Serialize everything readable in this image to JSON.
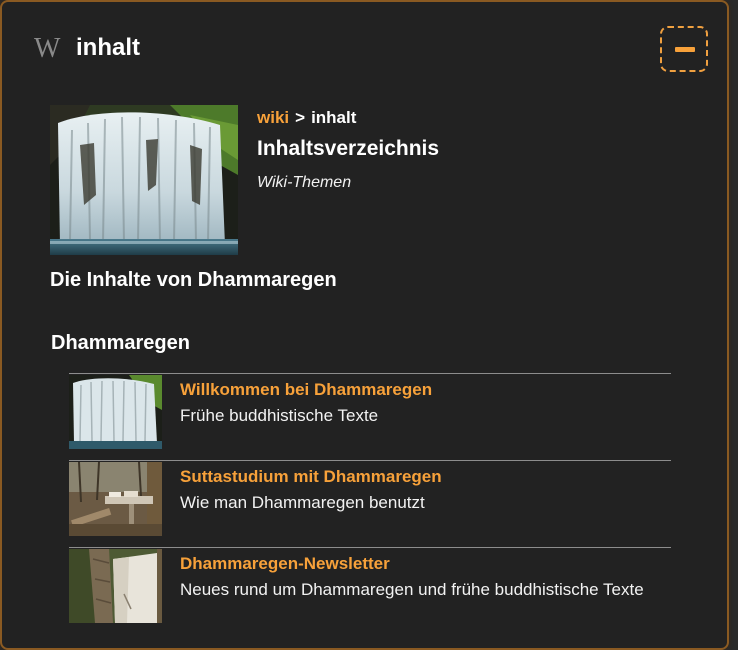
{
  "header": {
    "icon": "wikipedia-w-icon",
    "icon_glyph": "W",
    "title": "inhalt",
    "collapse_icon": "minus-icon"
  },
  "breadcrumb": {
    "link": "wiki",
    "separator": ">",
    "current": "inhalt"
  },
  "page": {
    "title": "Inhaltsverzeichnis",
    "subtitle": "Wiki-Themen",
    "hero_image": "waterfall-photo"
  },
  "section": {
    "heading": "Die Inhalte von Dhammaregen",
    "subheading": "Dhammaregen"
  },
  "entries": [
    {
      "title": "Willkommen bei Dhammaregen",
      "description": "Frühe buddhistische Texte",
      "image": "waterfall-photo"
    },
    {
      "title": "Suttastudium mit Dhammaregen",
      "description": "Wie man Dhammaregen benutzt",
      "image": "forest-bench-books-photo"
    },
    {
      "title": "Dhammaregen-Newsletter",
      "description": "Neues rund um Dhammaregen und frühe buddhistische Texte",
      "image": "tree-bark-paper-photo"
    }
  ],
  "colors": {
    "accent": "#f7a13a",
    "panel_background": "#222222",
    "panel_border": "#8a5a22",
    "divider": "#8d8d8d"
  }
}
